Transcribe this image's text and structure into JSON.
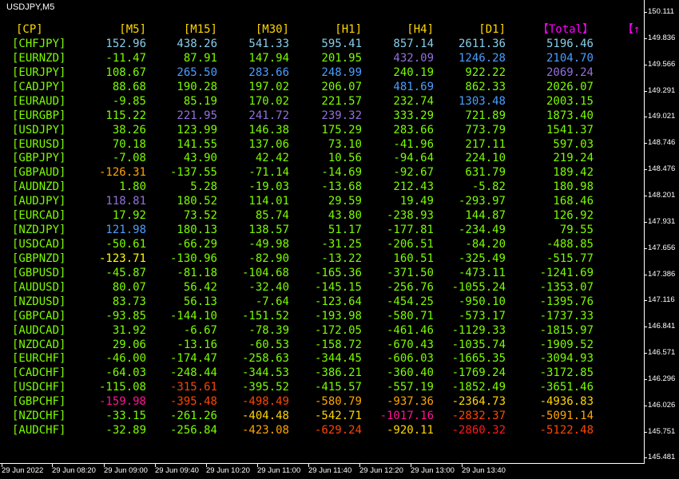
{
  "window": {
    "symbol_label": "USDJPY,M5"
  },
  "table": {
    "headers": [
      "[CP]",
      "[M5]",
      "[M15]",
      "[M30]",
      "[H1]",
      "[H4]",
      "[D1]",
      "【Total】",
      "【↑"
    ],
    "header_colors": [
      "#ffd700",
      "#ffd700",
      "#ffd700",
      "#ffd700",
      "#ffd700",
      "#ffd700",
      "#ffd700",
      "#ff00ff",
      "#ff00ff"
    ],
    "rows": [
      {
        "pair": "[CHFJPY]",
        "values": [
          "152.96",
          "438.26",
          "541.33",
          "595.41",
          "857.14",
          "2611.36",
          "5196.46"
        ],
        "colors": [
          "#87ceeb",
          "#87ceeb",
          "#87ceeb",
          "#87ceeb",
          "#87ceeb",
          "#87ceeb",
          "#87ceeb"
        ]
      },
      {
        "pair": "[EURNZD]",
        "values": [
          "-11.47",
          "87.91",
          "147.94",
          "201.95",
          "432.09",
          "1246.28",
          "2104.70"
        ],
        "colors": [
          "#7cfc00",
          "#7cfc00",
          "#7cfc00",
          "#7cfc00",
          "#9370db",
          "#4a9eff",
          "#4a9eff"
        ]
      },
      {
        "pair": "[EURJPY]",
        "values": [
          "108.67",
          "265.50",
          "283.66",
          "248.99",
          "240.19",
          "922.22",
          "2069.24"
        ],
        "colors": [
          "#7cfc00",
          "#4a9eff",
          "#4a9eff",
          "#4a9eff",
          "#7cfc00",
          "#7cfc00",
          "#9370db"
        ]
      },
      {
        "pair": "[CADJPY]",
        "values": [
          "88.68",
          "190.28",
          "197.02",
          "206.07",
          "481.69",
          "862.33",
          "2026.07"
        ],
        "colors": [
          "#7cfc00",
          "#7cfc00",
          "#7cfc00",
          "#7cfc00",
          "#4a9eff",
          "#7cfc00",
          "#7cfc00"
        ]
      },
      {
        "pair": "[EURAUD]",
        "values": [
          "-9.85",
          "85.19",
          "170.02",
          "221.57",
          "232.74",
          "1303.48",
          "2003.15"
        ],
        "colors": [
          "#7cfc00",
          "#7cfc00",
          "#7cfc00",
          "#7cfc00",
          "#7cfc00",
          "#4a9eff",
          "#7cfc00"
        ]
      },
      {
        "pair": "[EURGBP]",
        "values": [
          "115.22",
          "221.95",
          "241.72",
          "239.32",
          "333.29",
          "721.89",
          "1873.40"
        ],
        "colors": [
          "#7cfc00",
          "#9370db",
          "#9370db",
          "#9370db",
          "#7cfc00",
          "#7cfc00",
          "#7cfc00"
        ]
      },
      {
        "pair": "[USDJPY]",
        "values": [
          "38.26",
          "123.99",
          "146.38",
          "175.29",
          "283.66",
          "773.79",
          "1541.37"
        ],
        "colors": [
          "#7cfc00",
          "#7cfc00",
          "#7cfc00",
          "#7cfc00",
          "#7cfc00",
          "#7cfc00",
          "#7cfc00"
        ]
      },
      {
        "pair": "[EURUSD]",
        "values": [
          "70.18",
          "141.55",
          "137.06",
          "73.10",
          "-41.96",
          "217.11",
          "597.03"
        ],
        "colors": [
          "#7cfc00",
          "#7cfc00",
          "#7cfc00",
          "#7cfc00",
          "#7cfc00",
          "#7cfc00",
          "#7cfc00"
        ]
      },
      {
        "pair": "[GBPJPY]",
        "values": [
          "-7.08",
          "43.90",
          "42.42",
          "10.56",
          "-94.64",
          "224.10",
          "219.24"
        ],
        "colors": [
          "#7cfc00",
          "#7cfc00",
          "#7cfc00",
          "#7cfc00",
          "#7cfc00",
          "#7cfc00",
          "#7cfc00"
        ]
      },
      {
        "pair": "[GBPAUD]",
        "values": [
          "-126.31",
          "-137.55",
          "-71.14",
          "-14.69",
          "-92.67",
          "631.79",
          "189.42"
        ],
        "colors": [
          "#ffa500",
          "#7cfc00",
          "#7cfc00",
          "#7cfc00",
          "#7cfc00",
          "#7cfc00",
          "#7cfc00"
        ]
      },
      {
        "pair": "[AUDNZD]",
        "values": [
          "1.80",
          "5.28",
          "-19.03",
          "-13.68",
          "212.43",
          "-5.82",
          "180.98"
        ],
        "colors": [
          "#7cfc00",
          "#7cfc00",
          "#7cfc00",
          "#7cfc00",
          "#7cfc00",
          "#7cfc00",
          "#7cfc00"
        ]
      },
      {
        "pair": "[AUDJPY]",
        "values": [
          "118.81",
          "180.52",
          "114.01",
          "29.59",
          "19.49",
          "-293.97",
          "168.46"
        ],
        "colors": [
          "#9370db",
          "#7cfc00",
          "#7cfc00",
          "#7cfc00",
          "#7cfc00",
          "#7cfc00",
          "#7cfc00"
        ]
      },
      {
        "pair": "[EURCAD]",
        "values": [
          "17.92",
          "73.52",
          "85.74",
          "43.80",
          "-238.93",
          "144.87",
          "126.92"
        ],
        "colors": [
          "#7cfc00",
          "#7cfc00",
          "#7cfc00",
          "#7cfc00",
          "#7cfc00",
          "#7cfc00",
          "#7cfc00"
        ]
      },
      {
        "pair": "[NZDJPY]",
        "values": [
          "121.98",
          "180.13",
          "138.57",
          "51.17",
          "-177.81",
          "-234.49",
          "79.55"
        ],
        "colors": [
          "#4a9eff",
          "#7cfc00",
          "#7cfc00",
          "#7cfc00",
          "#7cfc00",
          "#7cfc00",
          "#7cfc00"
        ]
      },
      {
        "pair": "[USDCAD]",
        "values": [
          "-50.61",
          "-66.29",
          "-49.98",
          "-31.25",
          "-206.51",
          "-84.20",
          "-488.85"
        ],
        "colors": [
          "#7cfc00",
          "#7cfc00",
          "#7cfc00",
          "#7cfc00",
          "#7cfc00",
          "#7cfc00",
          "#7cfc00"
        ]
      },
      {
        "pair": "[GBPNZD]",
        "values": [
          "-123.71",
          "-130.96",
          "-82.90",
          "-13.22",
          "160.51",
          "-325.49",
          "-515.77"
        ],
        "colors": [
          "#ffff00",
          "#7cfc00",
          "#7cfc00",
          "#7cfc00",
          "#7cfc00",
          "#7cfc00",
          "#7cfc00"
        ]
      },
      {
        "pair": "[GBPUSD]",
        "values": [
          "-45.87",
          "-81.18",
          "-104.68",
          "-165.36",
          "-371.50",
          "-473.11",
          "-1241.69"
        ],
        "colors": [
          "#7cfc00",
          "#7cfc00",
          "#7cfc00",
          "#7cfc00",
          "#7cfc00",
          "#7cfc00",
          "#7cfc00"
        ]
      },
      {
        "pair": "[AUDUSD]",
        "values": [
          "80.07",
          "56.42",
          "-32.40",
          "-145.15",
          "-256.76",
          "-1055.24",
          "-1353.07"
        ],
        "colors": [
          "#7cfc00",
          "#7cfc00",
          "#7cfc00",
          "#7cfc00",
          "#7cfc00",
          "#7cfc00",
          "#7cfc00"
        ]
      },
      {
        "pair": "[NZDUSD]",
        "values": [
          "83.73",
          "56.13",
          "-7.64",
          "-123.64",
          "-454.25",
          "-950.10",
          "-1395.76"
        ],
        "colors": [
          "#7cfc00",
          "#7cfc00",
          "#7cfc00",
          "#7cfc00",
          "#7cfc00",
          "#7cfc00",
          "#7cfc00"
        ]
      },
      {
        "pair": "[GBPCAD]",
        "values": [
          "-93.85",
          "-144.10",
          "-151.52",
          "-193.98",
          "-580.71",
          "-573.17",
          "-1737.33"
        ],
        "colors": [
          "#7cfc00",
          "#7cfc00",
          "#7cfc00",
          "#7cfc00",
          "#7cfc00",
          "#7cfc00",
          "#7cfc00"
        ]
      },
      {
        "pair": "[AUDCAD]",
        "values": [
          "31.92",
          "-6.67",
          "-78.39",
          "-172.05",
          "-461.46",
          "-1129.33",
          "-1815.97"
        ],
        "colors": [
          "#7cfc00",
          "#7cfc00",
          "#7cfc00",
          "#7cfc00",
          "#7cfc00",
          "#7cfc00",
          "#7cfc00"
        ]
      },
      {
        "pair": "[NZDCAD]",
        "values": [
          "29.06",
          "-13.16",
          "-60.53",
          "-158.72",
          "-670.43",
          "-1035.74",
          "-1909.52"
        ],
        "colors": [
          "#7cfc00",
          "#7cfc00",
          "#7cfc00",
          "#7cfc00",
          "#7cfc00",
          "#7cfc00",
          "#7cfc00"
        ]
      },
      {
        "pair": "[EURCHF]",
        "values": [
          "-46.00",
          "-174.47",
          "-258.63",
          "-344.45",
          "-606.03",
          "-1665.35",
          "-3094.93"
        ],
        "colors": [
          "#7cfc00",
          "#7cfc00",
          "#7cfc00",
          "#7cfc00",
          "#7cfc00",
          "#7cfc00",
          "#7cfc00"
        ]
      },
      {
        "pair": "[CADCHF]",
        "values": [
          "-64.03",
          "-248.44",
          "-344.53",
          "-386.21",
          "-360.40",
          "-1769.24",
          "-3172.85"
        ],
        "colors": [
          "#7cfc00",
          "#7cfc00",
          "#7cfc00",
          "#7cfc00",
          "#7cfc00",
          "#7cfc00",
          "#7cfc00"
        ]
      },
      {
        "pair": "[USDCHF]",
        "values": [
          "-115.08",
          "-315.61",
          "-395.52",
          "-415.57",
          "-557.19",
          "-1852.49",
          "-3651.46"
        ],
        "colors": [
          "#7cfc00",
          "#ff4500",
          "#7cfc00",
          "#7cfc00",
          "#7cfc00",
          "#7cfc00",
          "#7cfc00"
        ]
      },
      {
        "pair": "[GBPCHF]",
        "values": [
          "-159.98",
          "-395.48",
          "-498.49",
          "-580.79",
          "-937.36",
          "-2364.73",
          "-4936.83"
        ],
        "colors": [
          "#ff1493",
          "#ff4500",
          "#ff4500",
          "#ffa500",
          "#ffa500",
          "#ffd700",
          "#ffd700"
        ]
      },
      {
        "pair": "[NZDCHF]",
        "values": [
          "-33.15",
          "-261.26",
          "-404.48",
          "-542.71",
          "-1017.16",
          "-2832.37",
          "-5091.14"
        ],
        "colors": [
          "#7cfc00",
          "#7cfc00",
          "#ffd700",
          "#ffd700",
          "#ff1493",
          "#ff4500",
          "#ffa500"
        ]
      },
      {
        "pair": "[AUDCHF]",
        "values": [
          "-32.89",
          "-256.84",
          "-423.08",
          "-629.24",
          "-920.11",
          "-2860.32",
          "-5122.48"
        ],
        "colors": [
          "#7cfc00",
          "#7cfc00",
          "#ffa500",
          "#ff4500",
          "#ffd700",
          "#ff1a1a",
          "#ff4500"
        ]
      }
    ]
  },
  "price_axis": [
    "150.111",
    "149.836",
    "149.566",
    "149.291",
    "149.021",
    "148.746",
    "148.476",
    "148.201",
    "147.931",
    "147.656",
    "147.386",
    "147.116",
    "146.841",
    "146.571",
    "146.296",
    "146.026",
    "145.751",
    "145.481"
  ],
  "time_axis": [
    "29 Jun 2022",
    "29 Jun 08:20",
    "29 Jun 09:00",
    "29 Jun 09:40",
    "29 Jun 10:20",
    "29 Jun 11:00",
    "29 Jun 11:40",
    "29 Jun 12:20",
    "29 Jun 13:00",
    "29 Jun 13:40"
  ],
  "colors": {
    "background": "#000000",
    "pair_label": "#7cfc00",
    "axis": "#ffffff"
  }
}
